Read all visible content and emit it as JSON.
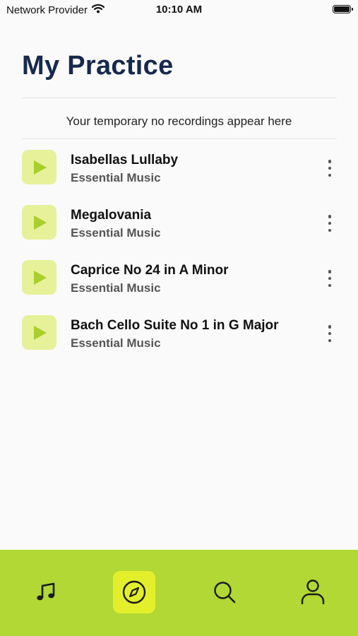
{
  "status_bar": {
    "carrier": "Network Provider",
    "time": "10:10 AM"
  },
  "page": {
    "title": "My Practice",
    "notice": "Your temporary no recordings appear here"
  },
  "tracks": [
    {
      "title": "Isabellas Lullaby",
      "subtitle": "Essential Music"
    },
    {
      "title": "Megalovania",
      "subtitle": "Essential Music"
    },
    {
      "title": "Caprice No 24 in A Minor",
      "subtitle": "Essential Music"
    },
    {
      "title": "Bach Cello Suite No 1 in G Major",
      "subtitle": "Essential Music"
    }
  ],
  "tab_bar": {
    "tabs": [
      {
        "icon": "music-note-icon",
        "active": false
      },
      {
        "icon": "compass-icon",
        "active": true
      },
      {
        "icon": "search-icon",
        "active": false
      },
      {
        "icon": "profile-icon",
        "active": false
      }
    ]
  },
  "colors": {
    "accent": "#b1d834",
    "active_tab": "#e4ef2c",
    "play_tile": "#e6f19a",
    "play_icon": "#a9cf2b",
    "title": "#17294d"
  }
}
